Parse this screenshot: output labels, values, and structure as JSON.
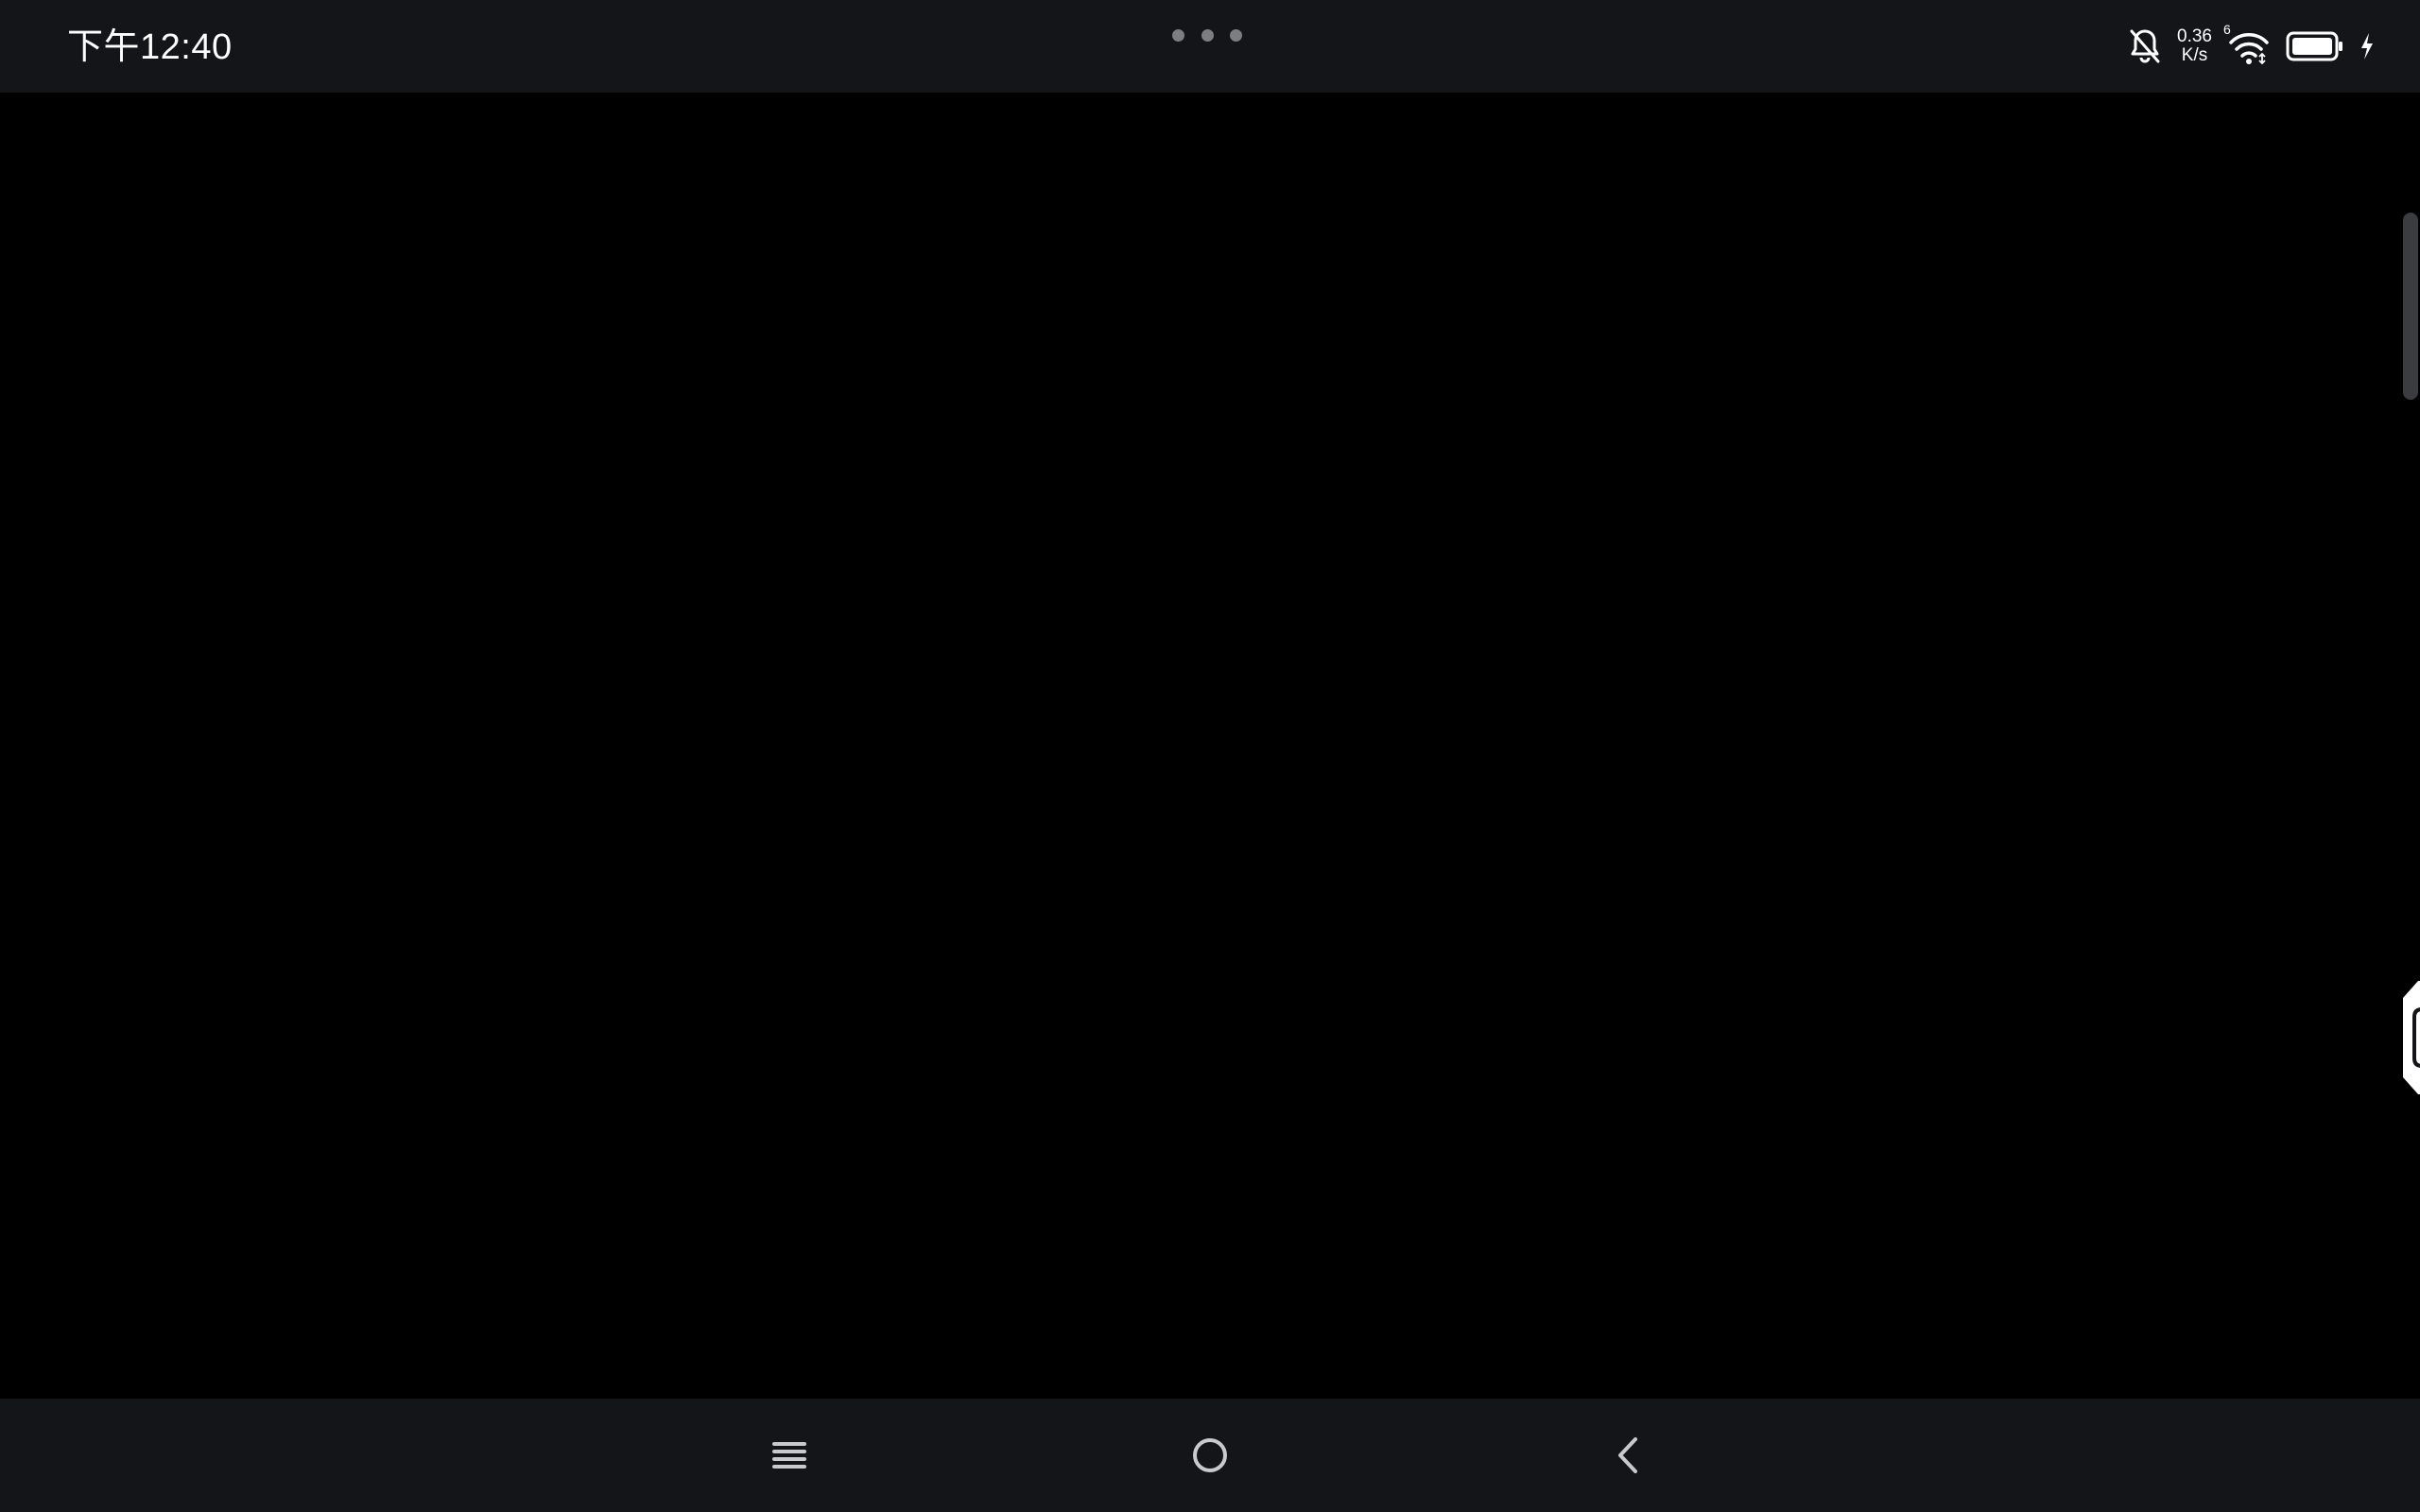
{
  "status_bar": {
    "time": "下午12:40",
    "net_speed_value": "0.36",
    "net_speed_unit": "K/s",
    "wifi_badge": "6",
    "icons": [
      "bell-muted-icon",
      "wifi-icon",
      "battery-icon",
      "charging-icon"
    ]
  },
  "multiwindow": {
    "icon": "more-dots-icon"
  },
  "navigation": {
    "icons": [
      "menu-icon",
      "home-icon",
      "back-icon"
    ]
  },
  "colors": {
    "background": "#000000",
    "bars": "#141519",
    "icon": "#ffffff",
    "nav_icon": "#c9cacd"
  }
}
